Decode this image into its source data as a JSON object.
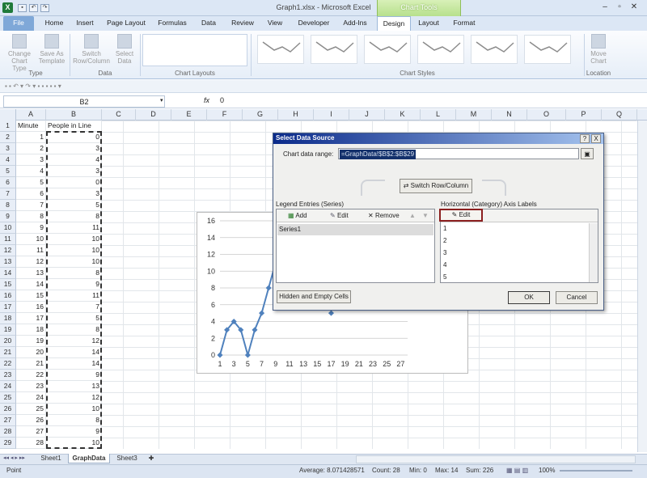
{
  "window": {
    "title": "Graph1.xlsx - Microsoft Excel",
    "app_letter": "X",
    "context_label": "Chart Tools"
  },
  "tabs": [
    "File",
    "Home",
    "Insert",
    "Page Layout",
    "Formulas",
    "Data",
    "Review",
    "View",
    "Developer",
    "Add-Ins",
    "Design",
    "Layout",
    "Format"
  ],
  "ribbon": {
    "change_type": [
      "Change",
      "Chart Type"
    ],
    "save_template": [
      "Save As",
      "Template"
    ],
    "switch_rowcol": [
      "Switch",
      "Row/Column"
    ],
    "select_data": [
      "Select",
      "Data"
    ],
    "move_chart": [
      "Move",
      "Chart"
    ],
    "groups": {
      "type": "Type",
      "data": "Data",
      "layouts": "Chart Layouts",
      "styles": "Chart Styles",
      "location": "Location"
    }
  },
  "formula_bar": {
    "name_box": "B2",
    "fx": "fx",
    "value": "0"
  },
  "columns": [
    "A",
    "B",
    "C",
    "D",
    "E",
    "F",
    "G",
    "H",
    "I",
    "J",
    "K",
    "L",
    "M",
    "N",
    "O",
    "P",
    "Q"
  ],
  "headers": {
    "a1": "Minute",
    "b1": "People in Line"
  },
  "table": {
    "minutes": [
      "1",
      "2",
      "3",
      "4",
      "5",
      "6",
      "7",
      "8",
      "9",
      "10",
      "11",
      "12",
      "13",
      "14",
      "15",
      "16",
      "17",
      "18",
      "19",
      "20",
      "21",
      "22",
      "23",
      "24",
      "25",
      "26",
      "27",
      "28"
    ],
    "people": [
      "0",
      "3",
      "4",
      "3",
      "0",
      "3",
      "5",
      "8",
      "11",
      "10",
      "10",
      "10",
      "8",
      "9",
      "11",
      "7",
      "5",
      "8",
      "12",
      "14",
      "14",
      "9",
      "13",
      "12",
      "10",
      "8",
      "9",
      "10"
    ]
  },
  "rows": [
    "1",
    "2",
    "3",
    "4",
    "5",
    "6",
    "7",
    "8",
    "9",
    "10",
    "11",
    "12",
    "13",
    "14",
    "15",
    "16",
    "17",
    "18",
    "19",
    "20",
    "21",
    "22",
    "23",
    "24",
    "25",
    "26",
    "27",
    "28",
    "29"
  ],
  "chart_data": {
    "type": "line",
    "x_ticks": [
      "1",
      "3",
      "5",
      "7",
      "9",
      "11",
      "13",
      "15",
      "17",
      "19",
      "21",
      "23",
      "25",
      "27"
    ],
    "y_ticks": [
      "0",
      "2",
      "4",
      "6",
      "8",
      "10",
      "12",
      "14",
      "16"
    ],
    "ylim": [
      0,
      16
    ],
    "xlim": [
      1,
      28
    ],
    "visible_points": [
      {
        "x": 1,
        "y": 0
      },
      {
        "x": 2,
        "y": 3
      },
      {
        "x": 3,
        "y": 4
      },
      {
        "x": 4,
        "y": 3
      },
      {
        "x": 5,
        "y": 0
      },
      {
        "x": 6,
        "y": 3
      },
      {
        "x": 7,
        "y": 5
      },
      {
        "x": 8,
        "y": 8
      },
      {
        "x": 9,
        "y": 11
      }
    ],
    "point_17": {
      "x": 17,
      "y": 5
    },
    "line_color": "#4f81bd"
  },
  "dialog": {
    "title": "Select Data Source",
    "range_label": "Chart data range:",
    "range_value": "=GraphData!$B$2:$B$29",
    "switch_label": "Switch Row/Column",
    "legend_label": "Legend Entries (Series)",
    "axis_label": "Horizontal (Category) Axis Labels",
    "add": "Add",
    "edit": "Edit",
    "remove": "Remove",
    "axis_edit": "Edit",
    "series": [
      "Series1"
    ],
    "axis_items": [
      "1",
      "2",
      "3",
      "4",
      "5"
    ],
    "hidden_cells": "Hidden and Empty Cells",
    "ok": "OK",
    "cancel": "Cancel",
    "help": "?",
    "close": "X"
  },
  "sheets": [
    "Sheet1",
    "GraphData",
    "Sheet3"
  ],
  "status": {
    "mode": "Point",
    "average": "Average: 8.071428571",
    "count": "Count: 28",
    "min": "Min: 0",
    "max": "Max: 14",
    "sum": "Sum: 226",
    "zoom": "100%"
  }
}
